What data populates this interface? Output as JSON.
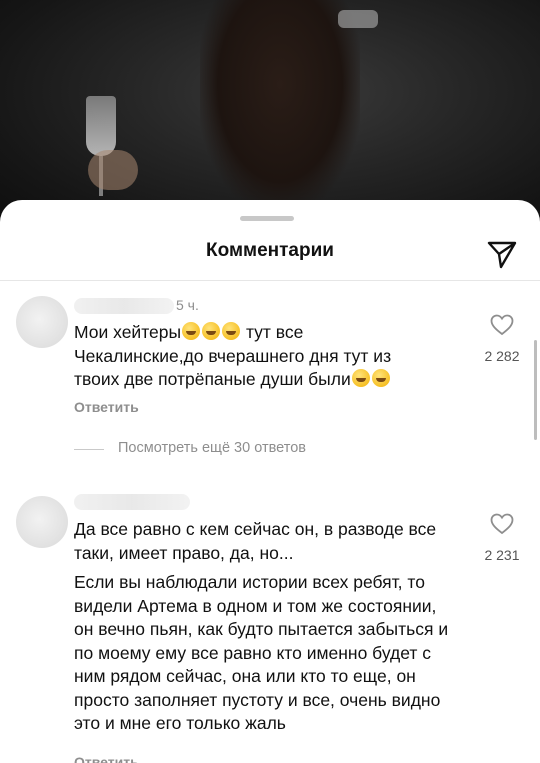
{
  "sheet": {
    "title": "Комментарии"
  },
  "comments": [
    {
      "time": "5 ч.",
      "lines": [
        "Мои хейтеры",
        "тут все",
        "Чекалинские,до вчерашнего дня тут из",
        "твоих две потрёпаные души были"
      ],
      "reply_label": "Ответить",
      "likes": "2 282",
      "view_more": "Посмотреть ещё 30 ответов"
    },
    {
      "paragraph1": "Да все равно с кем сейчас он, в разводе все таки, имеет право, да, но...",
      "paragraph2": "Если вы наблюдали истории всех ребят, то видели Артема в одном и том же состоянии, он вечно пьян, как будто пытается забыться и по моему ему все равно кто именно будет с ним рядом сейчас, она или кто то еще, он просто заполняет пустоту и все, очень видно это и мне его только жаль",
      "reply_label": "Ответить",
      "likes": "2 231"
    }
  ],
  "icons": {
    "share": "paper-plane-icon",
    "like": "heart-outline-icon",
    "emoji_sweat": "grinning-sweat-emoji",
    "emoji_laugh": "tears-of-joy-emoji",
    "emoji_squint": "squinting-face-emoji"
  },
  "colors": {
    "text": "#111111",
    "muted": "#8e8e8e",
    "sheet": "#ffffff"
  }
}
